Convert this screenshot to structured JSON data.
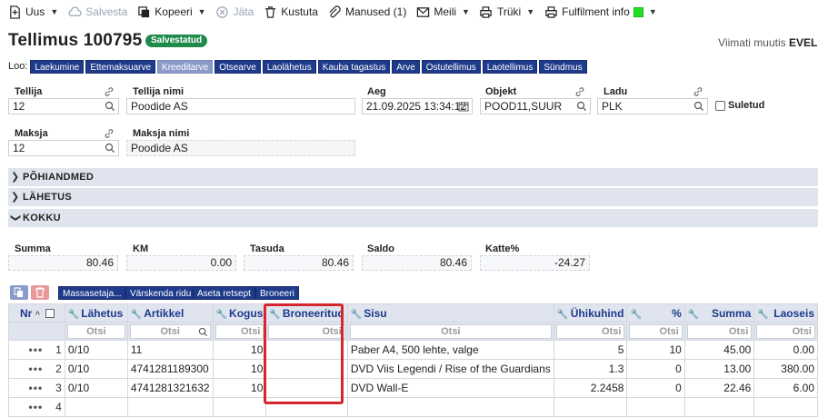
{
  "toolbar": {
    "new": "Uus",
    "save": "Salvesta",
    "copy": "Kopeeri",
    "cancel": "Jäta",
    "delete": "Kustuta",
    "attachments": "Manused (1)",
    "email": "Meili",
    "print": "Trüki",
    "fulfilment": "Fulfilment info"
  },
  "header": {
    "title": "Tellimus 100795",
    "status": "Salvestatud",
    "last_modified_label": "Viimati muutis",
    "last_modified_user": "EVELII"
  },
  "links": {
    "label": "Loo:",
    "items": [
      "Laekumine",
      "Ettemaksuarve",
      "Kreeditarve",
      "Otsearve",
      "Laolähetus",
      "Kauba tagastus",
      "Arve",
      "Ostutellimus",
      "Laotellimus",
      "Sündmus"
    ]
  },
  "fields": {
    "tellija": {
      "label": "Tellija",
      "value": "12"
    },
    "tellija_nimi": {
      "label": "Tellija nimi",
      "value": "Poodide AS"
    },
    "aeg": {
      "label": "Aeg",
      "value": "21.09.2025 13:34:12"
    },
    "objekt": {
      "label": "Objekt",
      "value": "POOD11,SUUR"
    },
    "ladu": {
      "label": "Ladu",
      "value": "PLK"
    },
    "suletud": {
      "label": "Suletud",
      "checked": false
    },
    "maksja": {
      "label": "Maksja",
      "value": "12"
    },
    "maksja_nimi": {
      "label": "Maksja nimi",
      "value": "Poodide AS"
    }
  },
  "sections": {
    "pohiandmed": "PÕHIANDMED",
    "lahetus": "LÄHETUS",
    "kokku": "KOKKU"
  },
  "totals": {
    "summa": {
      "label": "Summa",
      "value": "80.46"
    },
    "km": {
      "label": "KM",
      "value": "0.00"
    },
    "tasuda": {
      "label": "Tasuda",
      "value": "80.46"
    },
    "saldo": {
      "label": "Saldo",
      "value": "80.46"
    },
    "katte": {
      "label": "Katte%",
      "value": "-24.27"
    }
  },
  "grid_buttons": {
    "massasetaja": "Massasetaja...",
    "varskenda": "Värskenda ridu",
    "aseta": "Aseta retsept",
    "broneeri": "Broneeri"
  },
  "table": {
    "columns": {
      "nr": "Nr",
      "lahetus": "Lähetus",
      "artikkel": "Artikkel",
      "kogus": "Kogus",
      "broneeritud": "Broneeritud",
      "sisu": "Sisu",
      "uhikuhind": "Ühikuhind",
      "protsent": "%",
      "summa": "Summa",
      "laoseis": "Laoseis"
    },
    "filter_placeholder": "Otsi",
    "rows": [
      {
        "nr": "1",
        "lahetus": "0/10",
        "artikkel": "11",
        "kogus": "10",
        "broneeritud": "",
        "sisu": "Paber A4, 500 lehte, valge",
        "uhikuhind": "5",
        "protsent": "10",
        "summa": "45.00",
        "laoseis": "0.00"
      },
      {
        "nr": "2",
        "lahetus": "0/10",
        "artikkel": "4741281189300",
        "kogus": "10",
        "broneeritud": "",
        "sisu": "DVD Viis Legendi / Rise of the Guardians",
        "uhikuhind": "1.3",
        "protsent": "0",
        "summa": "13.00",
        "laoseis": "380.00"
      },
      {
        "nr": "3",
        "lahetus": "0/10",
        "artikkel": "4741281321632",
        "kogus": "10",
        "broneeritud": "",
        "sisu": "DVD Wall-E",
        "uhikuhind": "2.2458",
        "protsent": "0",
        "summa": "22.46",
        "laoseis": "6.00"
      },
      {
        "nr": "4",
        "lahetus": "",
        "artikkel": "",
        "kogus": "",
        "broneeritud": "",
        "sisu": "",
        "uhikuhind": "",
        "protsent": "",
        "summa": "",
        "laoseis": ""
      }
    ]
  },
  "colors": {
    "accent": "#1e3a8a",
    "status_green": "#1f8a4a",
    "section_bg": "#dfe4ee",
    "highlight": "#d7262b"
  }
}
